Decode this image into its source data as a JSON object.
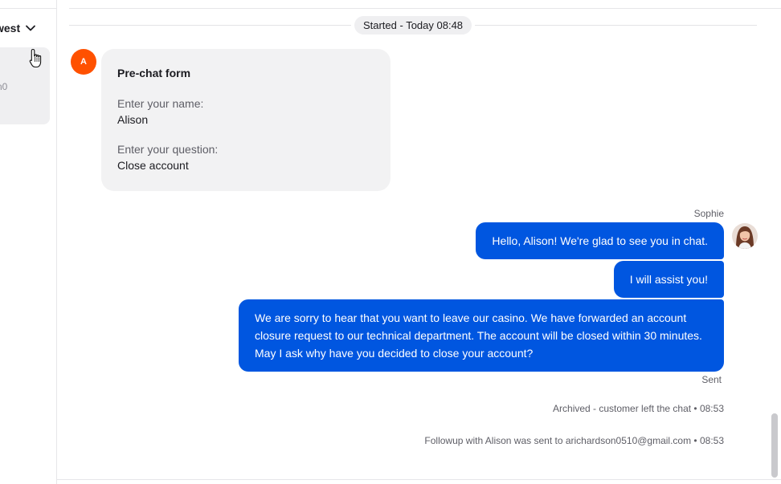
{
  "sidebar": {
    "sort_label": "west",
    "card_snippet": "n0",
    "icons": [
      "chevron-down-icon",
      "hand-pointer-cursor-icon"
    ]
  },
  "chat": {
    "started_label": "Started - Today 08:48",
    "customer_avatar_initial": "A",
    "customer_avatar_color": "#ff5100",
    "prechat": {
      "title": "Pre-chat form",
      "fields": [
        {
          "question": "Enter your name:",
          "answer": "Alison"
        },
        {
          "question": "Enter your question:",
          "answer": "Close account"
        }
      ]
    },
    "agent_name": "Sophie",
    "agent_bubble_color": "#0056e0",
    "messages": [
      "Hello, Alison! We're glad to see you in chat.",
      "I will assist you!",
      "We are sorry to hear that you want to leave our casino. We have forwarded an account closure request to our technical department. The account will be closed within 30 minutes. May I ask why have you decided to close your account?"
    ],
    "sent_status": "Sent",
    "system_events": [
      "Archived - customer left the chat • 08:53",
      "Followup with Alison was sent to arichardson0510@gmail.com • 08:53"
    ]
  }
}
